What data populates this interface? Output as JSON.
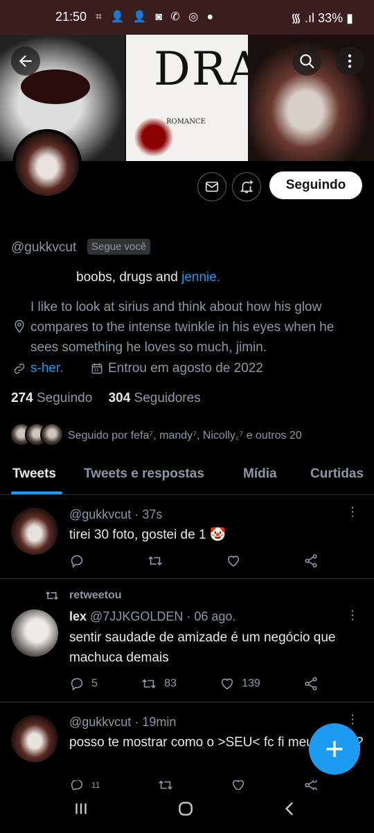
{
  "status_bar": {
    "time": "21:50",
    "notification_icons": "⌗ 👤 👤 ◙ ✆ ◎ ●",
    "signal_wifi": "᯾ .ıl",
    "battery": "33%"
  },
  "banner": {
    "book_title": "DRAK",
    "book_subtitle": "ROMANCE"
  },
  "profile": {
    "handle": "@gukkvcut",
    "follows_you_badge": "Segue você",
    "bio_line": "boobs, drugs and",
    "bio_link": "jennie.",
    "location": "I like to look at sirius and think about how his glow compares to the intense twinkle in his eyes when he sees something he loves so much, jimin.",
    "website": "s-her.",
    "joined": "Entrou em agosto de 2022",
    "following_count": "274",
    "following_label": "Seguindo",
    "followers_count": "304",
    "followers_label": "Seguidores",
    "followed_by": "Seguido por fefa⁷, mandy⁷, Nicolly꜀⁷ e outros 20",
    "follow_button": "Seguindo"
  },
  "tabs": [
    "Tweets",
    "Tweets e respostas",
    "Mídia",
    "Curtidas"
  ],
  "tweets": [
    {
      "handle": "@gukkvcut",
      "time": "· 37s",
      "text": "tirei 30 foto, gostei de 1 🤡",
      "replies": "",
      "retweets": "",
      "likes": ""
    },
    {
      "retweet_label": "retweetou",
      "name": "lex",
      "handle": "@7JJKGOLDEN",
      "time": "· 06 ago.",
      "text": "sentir saudade de amizade é um negócio que machuca demais",
      "replies": "5",
      "retweets": "83",
      "likes": "139"
    },
    {
      "handle": "@gukkvcut",
      "time": "· 19min",
      "text": "posso te mostrar como o >SEU< fc fi meu celular?",
      "replies": "11",
      "retweets": "",
      "likes": ""
    }
  ],
  "colors": {
    "accent": "#1d9bf0",
    "background": "#000000",
    "status_bar": "#3a1e1e",
    "secondary_text": "#8b98a5",
    "divider": "#2f3336"
  },
  "icons": {
    "back": "arrow-left-icon",
    "search": "search-icon",
    "more": "more-vertical-icon",
    "message": "envelope-icon",
    "notify": "bell-plus-icon",
    "location": "location-pin-icon",
    "link": "link-icon",
    "calendar": "calendar-icon",
    "reply": "reply-icon",
    "retweet": "retweet-icon",
    "like": "heart-icon",
    "share": "share-icon",
    "compose": "plus-icon"
  }
}
